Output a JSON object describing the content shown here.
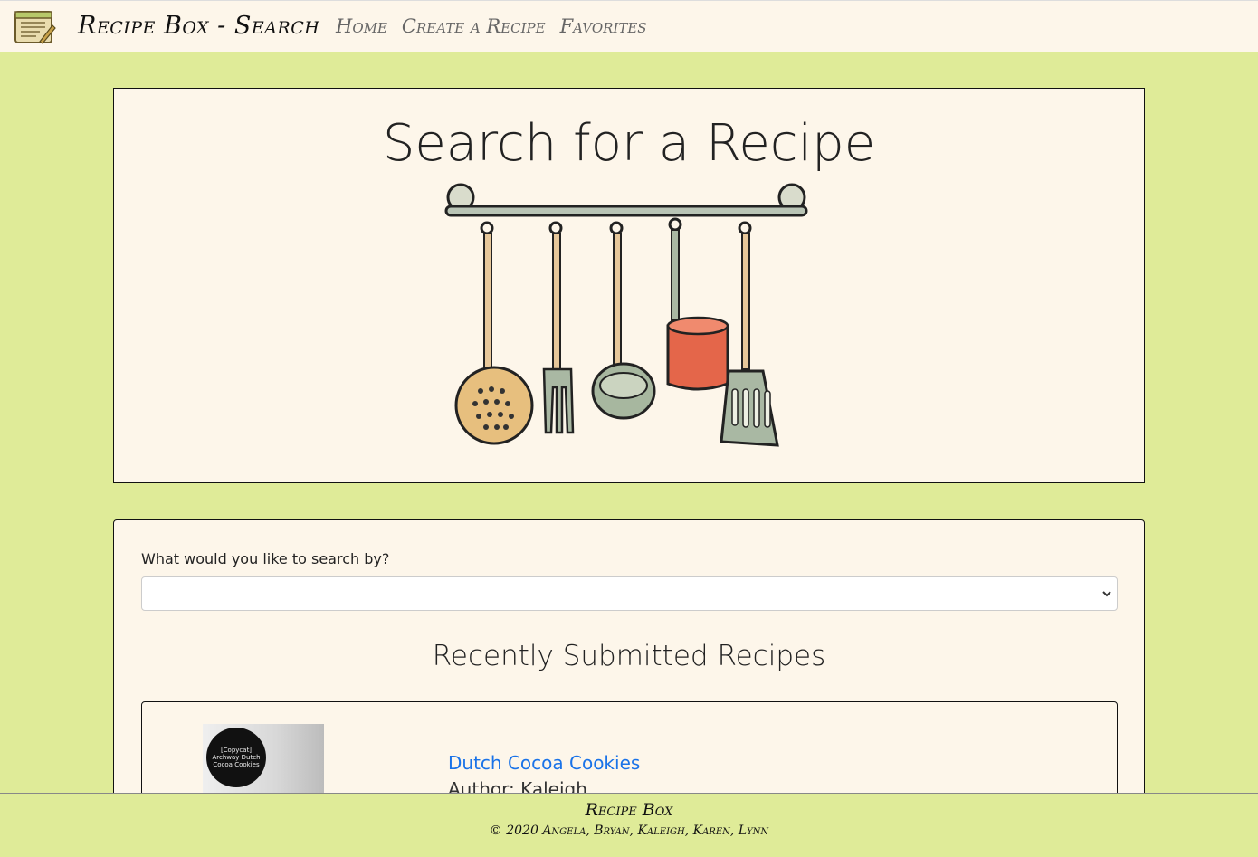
{
  "navbar": {
    "brand_title": "Recipe Box - Search",
    "links": [
      {
        "label": "Home"
      },
      {
        "label": "Create a Recipe"
      },
      {
        "label": "Favorites"
      }
    ]
  },
  "hero": {
    "title": "Search for a Recipe"
  },
  "search": {
    "label": "What would you like to search by?",
    "selected_value": ""
  },
  "recent": {
    "heading": "Recently Submitted Recipes",
    "recipes": [
      {
        "title": "Dutch Cocoa Cookies",
        "author": "Author: Kaleigh",
        "thumb_text": "[Copycat] Archway Dutch Cocoa Cookies"
      }
    ]
  },
  "footer": {
    "brand": "Recipe Box",
    "copyright": "© 2020 Angela, Bryan, Kaleigh, Karen, Lynn"
  },
  "colors": {
    "page_bg": "#dfeb98",
    "card_bg": "#fdf6ea",
    "link": "#1a73e8"
  }
}
